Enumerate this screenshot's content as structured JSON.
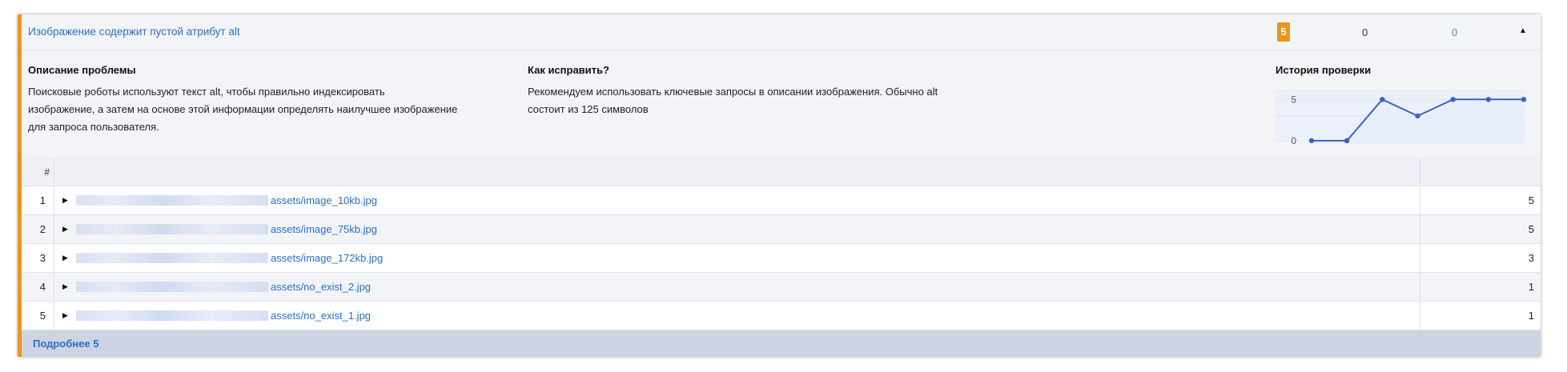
{
  "issue": {
    "title": "Изображение содержит пустой атрибут alt",
    "errors_count": "5",
    "warnings_count": "0",
    "ok_count": "0",
    "collapse_glyph": "▲"
  },
  "description": {
    "heading": "Описание проблемы",
    "text_lines": [
      "Поисковые роботы используют текст alt, чтобы правильно индексировать",
      "изображение, а затем на основе этой информации определять наилучшее изображение",
      "для запроса пользователя."
    ]
  },
  "fix": {
    "heading": "Как исправить?",
    "text_lines": [
      "Рекомендуем использовать ключевые запросы в описании изображения. Обычно alt",
      "состоит из 125 символов"
    ]
  },
  "history": {
    "heading": "История проверки"
  },
  "chart_data": {
    "type": "line",
    "title": "",
    "x": [
      1,
      2,
      3,
      4,
      5,
      6,
      7
    ],
    "series": [
      {
        "values": [
          0,
          0,
          5,
          3,
          5,
          5,
          5
        ]
      }
    ],
    "ylim": [
      -0.5,
      6
    ],
    "yticks": [
      "5",
      "0"
    ],
    "grid": true,
    "line_color": "#3a62c4",
    "area_color": "#e8edfb"
  },
  "table": {
    "num_header": "#",
    "rows": [
      {
        "num": "1",
        "url": "assets/image_10kb.jpg",
        "value": "5"
      },
      {
        "num": "2",
        "url": "assets/image_75kb.jpg",
        "value": "5"
      },
      {
        "num": "3",
        "url": "assets/image_172kb.jpg",
        "value": "3"
      },
      {
        "num": "4",
        "url": "assets/no_exist_2.jpg",
        "value": "1"
      },
      {
        "num": "5",
        "url": "assets/no_exist_1.jpg",
        "value": "1"
      }
    ],
    "expand_glyph": "▶"
  },
  "footer": {
    "more_label": "Подробнее 5"
  },
  "colors": {
    "accent": "#f0931e",
    "link": "#2a6ec6",
    "ok": "#3cae45"
  },
  "icons": {
    "expand": "chevron-right-icon",
    "collapse": "chevron-up-icon"
  }
}
